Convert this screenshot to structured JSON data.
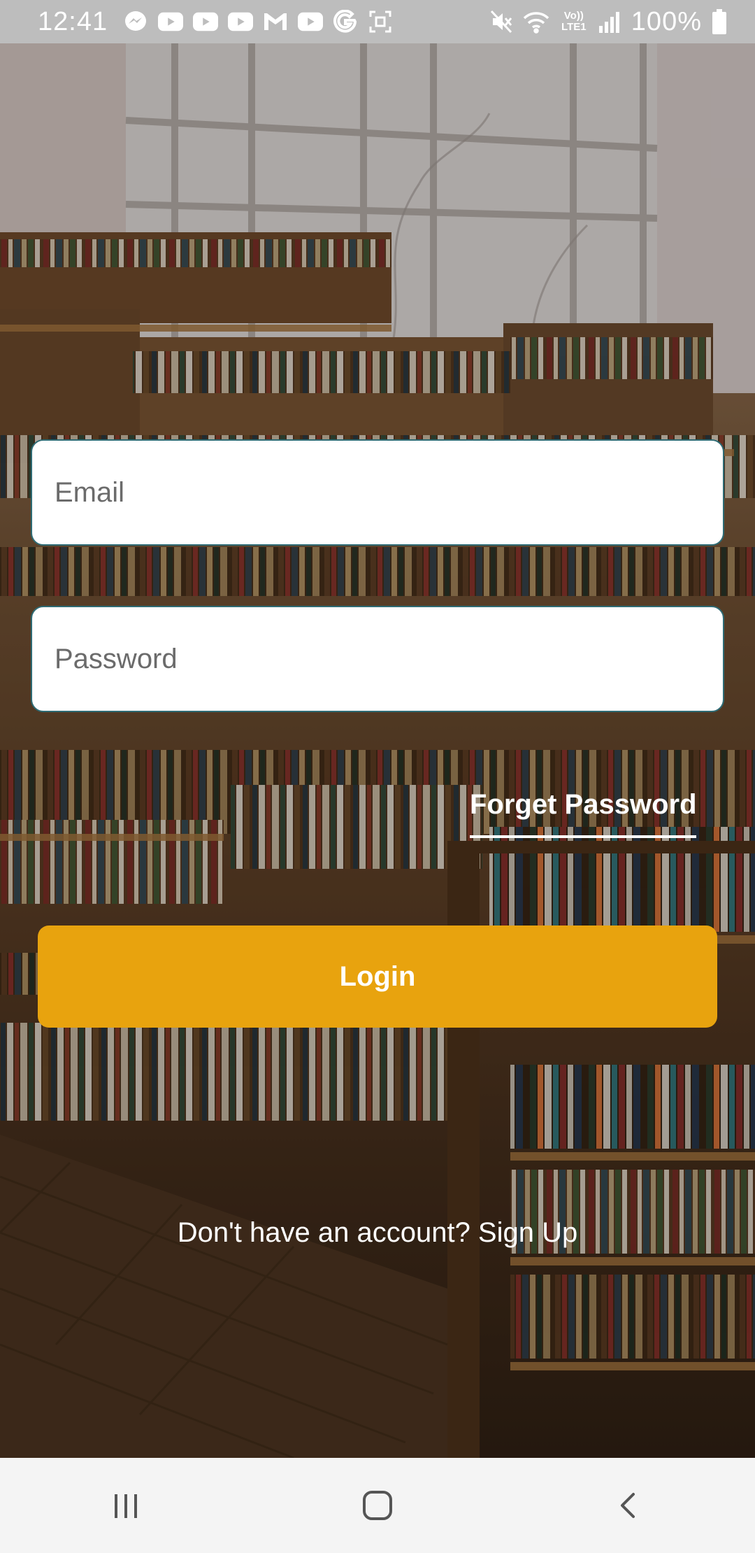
{
  "status_bar": {
    "time": "12:41",
    "notification_icons": [
      "messenger-icon",
      "youtube-icon",
      "youtube-icon",
      "youtube-icon",
      "gmail-icon",
      "youtube-icon",
      "google-icon",
      "screenshot-icon"
    ],
    "system_icons": [
      "mute-icon",
      "wifi-icon",
      "volte-icon",
      "signal-icon"
    ],
    "volte_label": "Vo)) LTE1",
    "battery_percent": "100%"
  },
  "form": {
    "email_placeholder": "Email",
    "password_placeholder": "Password",
    "forget_password_label": "Forget Password",
    "login_label": "Login",
    "signup_prompt": "Don't have an account? ",
    "signup_link": "Sign Up"
  },
  "colors": {
    "accent": "#e8a30e",
    "field_border": "#2e6b74",
    "status_bar": "#bdbdbd",
    "nav_bar": "#f4f4f4"
  },
  "nav_bar": {
    "icons": [
      "recent-apps-icon",
      "home-icon",
      "back-icon"
    ]
  }
}
